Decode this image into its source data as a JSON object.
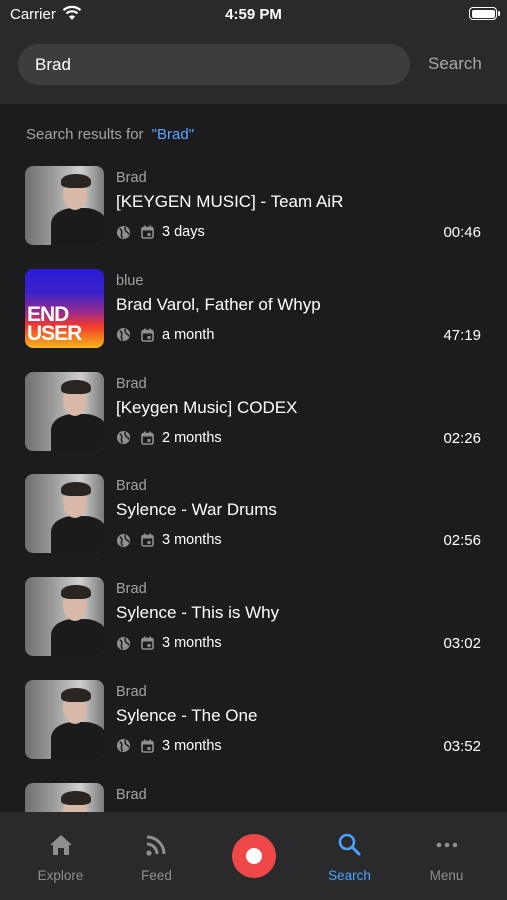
{
  "status_bar": {
    "carrier": "Carrier",
    "time": "4:59 PM"
  },
  "search": {
    "value": "Brad",
    "button_label": "Search"
  },
  "results_heading": {
    "prefix": "Search results for",
    "query": "\"Brad\""
  },
  "results": [
    {
      "artist": "Brad",
      "title": "[KEYGEN MUSIC] - Team AiR",
      "age": "3 days",
      "duration": "00:46",
      "thumb": "portrait"
    },
    {
      "artist": "blue",
      "title": "Brad Varol, Father of Whyp",
      "age": "a month",
      "duration": "47:19",
      "thumb": "album",
      "thumb_text": "END USER"
    },
    {
      "artist": "Brad",
      "title": "[Keygen Music] CODEX",
      "age": "2 months",
      "duration": "02:26",
      "thumb": "portrait"
    },
    {
      "artist": "Brad",
      "title": "Sylence - War Drums",
      "age": "3 months",
      "duration": "02:56",
      "thumb": "portrait"
    },
    {
      "artist": "Brad",
      "title": "Sylence - This is Why",
      "age": "3 months",
      "duration": "03:02",
      "thumb": "portrait"
    },
    {
      "artist": "Brad",
      "title": "Sylence - The One",
      "age": "3 months",
      "duration": "03:52",
      "thumb": "portrait"
    },
    {
      "artist": "Brad",
      "title": "",
      "age": "",
      "duration": "",
      "thumb": "portrait"
    }
  ],
  "tabs": {
    "explore": {
      "label": "Explore",
      "icon": "home-icon"
    },
    "feed": {
      "label": "Feed",
      "icon": "rss-icon"
    },
    "record": {
      "icon": "record-icon"
    },
    "search": {
      "label": "Search",
      "icon": "search-icon",
      "active": true
    },
    "menu": {
      "label": "Menu",
      "icon": "more-icon"
    }
  },
  "colors": {
    "background": "#1c1c1e",
    "header": "#2a2a2c",
    "accent": "#4aa3ff",
    "record": "#f04848"
  }
}
